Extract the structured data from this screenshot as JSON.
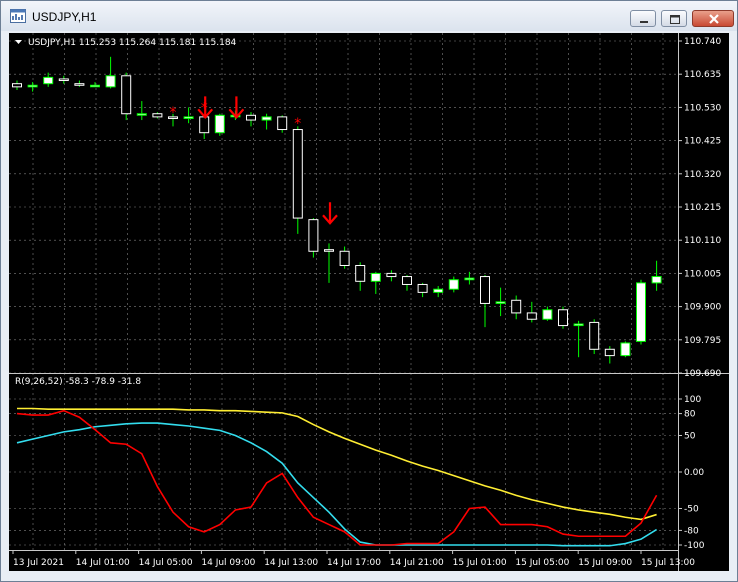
{
  "window": {
    "title": "USDJPY,H1",
    "buttons": [
      "minimize",
      "maximize",
      "close"
    ]
  },
  "main_panel": {
    "header": "USDJPY,H1  115.253 115.264 115.181 115.184",
    "price_labels": [
      "110.740",
      "110.635",
      "110.530",
      "110.425",
      "110.320",
      "110.215",
      "110.110",
      "110.005",
      "109.900",
      "109.795",
      "109.690"
    ],
    "arrow_color": "#ff0000",
    "bull_color": "#ffffff",
    "bear_color": "#ffffff",
    "wick_color": "#00ff00"
  },
  "indicator_panel": {
    "header": "R(9,26,52) -58.3 -78.9 -31.8",
    "levels": [
      "100",
      "80",
      "50",
      "0.00",
      "-50",
      "-80",
      "-100"
    ],
    "colors": {
      "red": "#ff0000",
      "cyan": "#33ddee",
      "yellow": "#ffee33"
    }
  },
  "time_axis": {
    "labels": [
      "13 Jul 2021",
      "14 Jul 01:00",
      "14 Jul 05:00",
      "14 Jul 09:00",
      "14 Jul 13:00",
      "14 Jul 17:00",
      "14 Jul 21:00",
      "15 Jul 01:00",
      "15 Jul 05:00",
      "15 Jul 09:00",
      "15 Jul 13:00"
    ]
  },
  "chart_data": {
    "type": "candlestick",
    "symbol": "USDJPY",
    "timeframe": "H1",
    "ylim": [
      109.69,
      110.74
    ],
    "candles": [
      {
        "o": 110.605,
        "h": 110.615,
        "l": 110.585,
        "c": 110.595
      },
      {
        "o": 110.595,
        "h": 110.61,
        "l": 110.58,
        "c": 110.6
      },
      {
        "o": 110.605,
        "h": 110.64,
        "l": 110.595,
        "c": 110.625
      },
      {
        "o": 110.62,
        "h": 110.63,
        "l": 110.605,
        "c": 110.615
      },
      {
        "o": 110.605,
        "h": 110.615,
        "l": 110.595,
        "c": 110.6
      },
      {
        "o": 110.6,
        "h": 110.61,
        "l": 110.595,
        "c": 110.6
      },
      {
        "o": 110.595,
        "h": 110.69,
        "l": 110.59,
        "c": 110.63
      },
      {
        "o": 110.63,
        "h": 110.64,
        "l": 110.49,
        "c": 110.51
      },
      {
        "o": 110.51,
        "h": 110.55,
        "l": 110.49,
        "c": 110.51
      },
      {
        "o": 110.51,
        "h": 110.515,
        "l": 110.495,
        "c": 110.5
      },
      {
        "o": 110.5,
        "h": 110.51,
        "l": 110.47,
        "c": 110.495
      },
      {
        "o": 110.495,
        "h": 110.53,
        "l": 110.48,
        "c": 110.5
      },
      {
        "o": 110.5,
        "h": 110.505,
        "l": 110.43,
        "c": 110.45
      },
      {
        "o": 110.45,
        "h": 110.51,
        "l": 110.44,
        "c": 110.505
      },
      {
        "o": 110.505,
        "h": 110.52,
        "l": 110.49,
        "c": 110.505
      },
      {
        "o": 110.505,
        "h": 110.515,
        "l": 110.47,
        "c": 110.49
      },
      {
        "o": 110.49,
        "h": 110.51,
        "l": 110.46,
        "c": 110.5
      },
      {
        "o": 110.5,
        "h": 110.505,
        "l": 110.45,
        "c": 110.46
      },
      {
        "o": 110.46,
        "h": 110.47,
        "l": 110.13,
        "c": 110.18
      },
      {
        "o": 110.175,
        "h": 110.18,
        "l": 110.055,
        "c": 110.075
      },
      {
        "o": 110.08,
        "h": 110.1,
        "l": 109.975,
        "c": 110.075
      },
      {
        "o": 110.075,
        "h": 110.09,
        "l": 110.02,
        "c": 110.03
      },
      {
        "o": 110.03,
        "h": 110.04,
        "l": 109.95,
        "c": 109.98
      },
      {
        "o": 109.98,
        "h": 110.01,
        "l": 109.94,
        "c": 110.005
      },
      {
        "o": 110.005,
        "h": 110.015,
        "l": 109.98,
        "c": 109.995
      },
      {
        "o": 109.995,
        "h": 110.0,
        "l": 109.95,
        "c": 109.97
      },
      {
        "o": 109.97,
        "h": 109.975,
        "l": 109.93,
        "c": 109.945
      },
      {
        "o": 109.945,
        "h": 109.965,
        "l": 109.93,
        "c": 109.955
      },
      {
        "o": 109.955,
        "h": 109.995,
        "l": 109.945,
        "c": 109.985
      },
      {
        "o": 109.985,
        "h": 110.01,
        "l": 109.97,
        "c": 109.99
      },
      {
        "o": 109.995,
        "h": 110.0,
        "l": 109.835,
        "c": 109.91
      },
      {
        "o": 109.91,
        "h": 109.96,
        "l": 109.87,
        "c": 109.915
      },
      {
        "o": 109.92,
        "h": 109.935,
        "l": 109.86,
        "c": 109.88
      },
      {
        "o": 109.88,
        "h": 109.915,
        "l": 109.85,
        "c": 109.86
      },
      {
        "o": 109.86,
        "h": 109.9,
        "l": 109.855,
        "c": 109.89
      },
      {
        "o": 109.89,
        "h": 109.9,
        "l": 109.83,
        "c": 109.84
      },
      {
        "o": 109.84,
        "h": 109.855,
        "l": 109.74,
        "c": 109.845
      },
      {
        "o": 109.85,
        "h": 109.86,
        "l": 109.75,
        "c": 109.765
      },
      {
        "o": 109.765,
        "h": 109.775,
        "l": 109.72,
        "c": 109.745
      },
      {
        "o": 109.745,
        "h": 109.79,
        "l": 109.74,
        "c": 109.785
      },
      {
        "o": 109.79,
        "h": 109.985,
        "l": 109.78,
        "c": 109.975
      },
      {
        "o": 109.975,
        "h": 110.045,
        "l": 109.95,
        "c": 109.995
      }
    ],
    "arrows": [
      {
        "index": 12,
        "price": 110.565,
        "type": "down-arrow"
      },
      {
        "index": 14,
        "price": 110.565,
        "type": "down-arrow"
      },
      {
        "index": 20,
        "price": 110.23,
        "type": "down-arrow"
      }
    ],
    "stars": [
      {
        "index": 10,
        "price": 110.515
      },
      {
        "index": 12,
        "price": 110.53
      },
      {
        "index": 18,
        "price": 110.48
      }
    ],
    "indicator": {
      "name": "R(9,26,52)",
      "values_shown": [
        -58.3,
        -78.9,
        -31.8
      ],
      "ylim": [
        -100,
        100
      ],
      "red": [
        80,
        78,
        78,
        84,
        75,
        58,
        40,
        38,
        25,
        -20,
        -55,
        -75,
        -82,
        -72,
        -52,
        -48,
        -15,
        -2,
        -35,
        -62,
        -72,
        -82,
        -100,
        -100,
        -100,
        -98,
        -98,
        -98,
        -82,
        -50,
        -48,
        -72,
        -72,
        -72,
        -75,
        -85,
        -88,
        -88,
        -88,
        -88,
        -70,
        -31.8
      ],
      "cyan": [
        40,
        45,
        50,
        55,
        58,
        62,
        64,
        66,
        67,
        67,
        65,
        63,
        60,
        57,
        50,
        40,
        28,
        12,
        -15,
        -35,
        -55,
        -78,
        -96,
        -100,
        -100,
        -100,
        -100,
        -100,
        -100,
        -100,
        -100,
        -100,
        -100,
        -100,
        -100,
        -101,
        -101,
        -101,
        -101,
        -98,
        -92,
        -78.9
      ],
      "yellow": [
        87,
        87,
        86,
        86,
        86,
        86,
        86,
        86,
        86,
        86,
        86,
        85,
        85,
        84,
        84,
        83,
        82,
        81,
        76,
        65,
        55,
        46,
        38,
        30,
        23,
        15,
        8,
        2,
        -5,
        -12,
        -19,
        -25,
        -32,
        -38,
        -43,
        -48,
        -52,
        -55,
        -58,
        -62,
        -65,
        -58.3
      ]
    }
  }
}
